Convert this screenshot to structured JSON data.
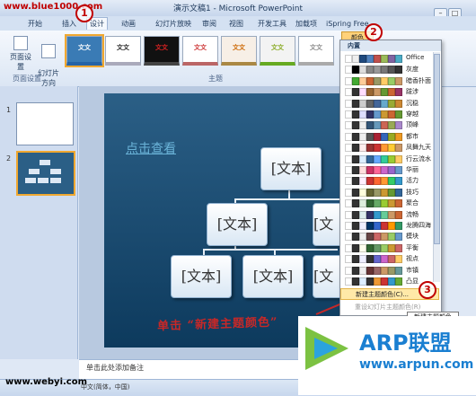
{
  "site_top": "www.blue1000.com",
  "site_bottom": "www.webyi.com",
  "window": {
    "title": "演示文稿1 - Microsoft PowerPoint"
  },
  "tabs": [
    "开始",
    "插入",
    "设计",
    "动画",
    "幻灯片放映",
    "审阅",
    "视图",
    "开发工具",
    "加载项",
    "iSpring Free"
  ],
  "active_tab_index": 2,
  "ribbon": {
    "page_setup_label": "页面设置",
    "slide_orient_label": "幻灯片\n方向",
    "page_group_label": "页面设置",
    "themes_group_label": "主题",
    "colors_button": "颜色",
    "theme_labels": [
      "文文",
      "文文",
      "文文",
      "文文",
      "文文",
      "文文",
      "文文"
    ]
  },
  "slides": {
    "numbers": [
      "1",
      "2"
    ]
  },
  "slide": {
    "title": "点击查看",
    "boxes": [
      "[文本]",
      "[文本]",
      "[文本]",
      "[文本]",
      "[文本]",
      "[文本]",
      "[文本]"
    ]
  },
  "annotation": "单击 “新建主题颜色”",
  "notes_placeholder": "单击此处添加备注",
  "status": {
    "lang": "中文(简体，中国)"
  },
  "dropdown": {
    "header": "内置",
    "items": [
      "Office",
      "灰度",
      "暗香扑面",
      "跋涉",
      "沉稳",
      "穿越",
      "顶峰",
      "都市",
      "凤舞九天",
      "行云流水",
      "华丽",
      "活力",
      "技巧",
      "聚合",
      "流畅",
      "龙腾四海",
      "模块",
      "平衡",
      "视点",
      "市镇",
      "凸显"
    ],
    "new_theme_colors": "新建主题颜色(C)...",
    "reset_colors": "重设幻灯片主题颜色(R)",
    "tooltip": "新建主题颜色"
  },
  "markers": [
    "1",
    "2",
    "3"
  ],
  "brand": {
    "title": "ARP联盟",
    "url": "www.arpun.com"
  }
}
